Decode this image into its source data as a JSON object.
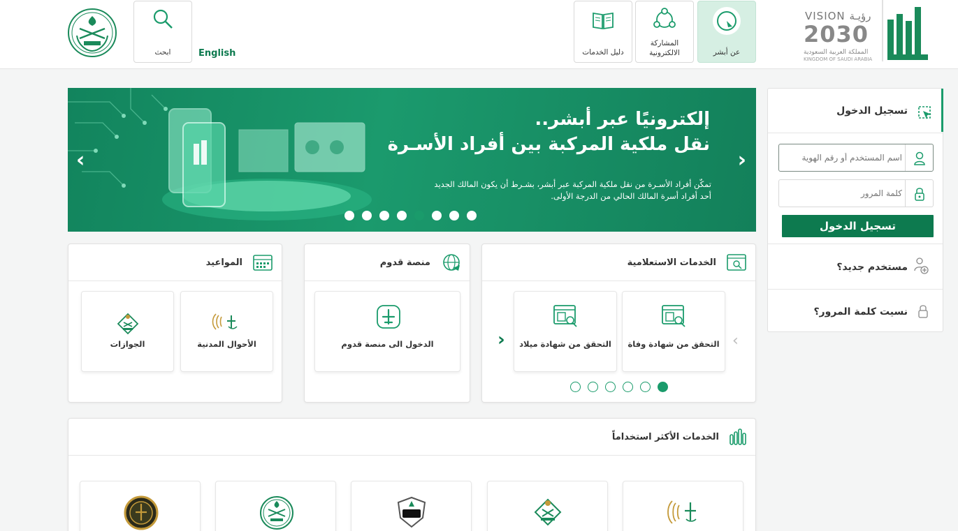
{
  "header": {
    "nav": [
      {
        "label": "عن أبشر",
        "icon": "absher-icon"
      },
      {
        "label_line1": "المشاركة",
        "label_line2": "الالكترونية",
        "icon": "participation-icon"
      },
      {
        "label": "دليل الخدمات",
        "icon": "book-icon"
      }
    ],
    "search_label": "ابحث",
    "language": "English",
    "vision": {
      "line1": "VISION رؤيـة",
      "line2": "2030",
      "line3": "المملكة العربية السعودية",
      "line4": "KINGDOM OF SAUDI ARABIA"
    }
  },
  "banner": {
    "title1": "إلكترونيًا عبر أبشر..",
    "title2": "نقل ملكية المركبة بين أفراد الأسـرة",
    "desc1": "تمكّن أفراد الأسـرة من نقل ملكية المركبة عبر أبشر، بشـرط أن يكون المالك الجديد",
    "desc2": "أحد أفراد أسرة المالك الحالي من الدرجة الأولى.",
    "slide_count": 8,
    "active_slide": 5
  },
  "inquiry": {
    "title": "الخدمات الاستعلامية",
    "items": [
      {
        "label": "التحقق من شهادة وفاة",
        "icon": "certificate-search-icon"
      },
      {
        "label": "التحقق من شهادة ميلاد",
        "icon": "certificate-search-icon"
      }
    ],
    "page_count": 6,
    "active_page": 1
  },
  "qudoom": {
    "title": "منصة قدوم",
    "items": [
      {
        "label": "الدخول الى منصة قدوم",
        "icon": "airplane-icon"
      }
    ]
  },
  "appointments": {
    "title": "المواعيد",
    "items": [
      {
        "label": "الأحوال المدنية",
        "icon": "civil-affairs-logo"
      },
      {
        "label": "الجوازات",
        "icon": "passports-logo"
      }
    ]
  },
  "most_used": {
    "title": "الخدمات الأكثر استخداماً",
    "items": [
      {
        "icon": "civil-affairs-logo"
      },
      {
        "icon": "passports-logo"
      },
      {
        "icon": "public-security-logo"
      },
      {
        "icon": "moi-emblem-logo"
      },
      {
        "icon": "gold-emblem-logo"
      }
    ]
  },
  "login": {
    "title": "تسجيل الدخول",
    "username_placeholder": "اسم المستخدم أو رقم الهوية",
    "password_placeholder": "كلمة المرور",
    "button": "تسجيل الدخول",
    "new_user": "مستخدم جديد؟",
    "forgot": "نسيت كلمة المرور؟"
  },
  "colors": {
    "primary": "#0d7a4f",
    "accent": "#1a9b6b"
  }
}
